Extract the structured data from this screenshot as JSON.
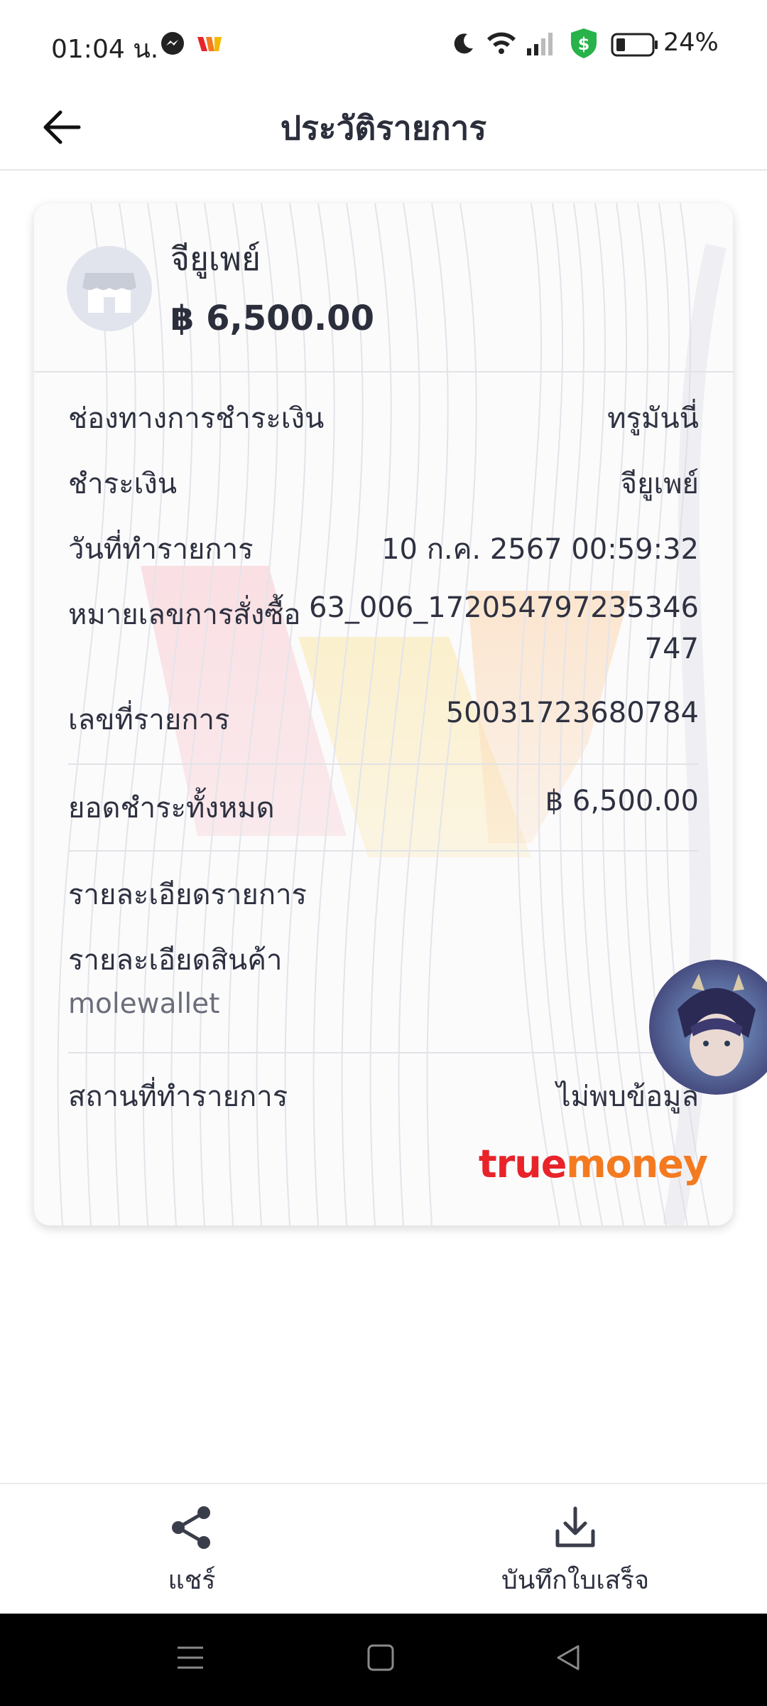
{
  "status_bar": {
    "time": "01:04 น.",
    "battery": "24%",
    "icons": [
      "messenger-icon",
      "app-icon",
      "moon-icon",
      "wifi-icon",
      "signal-icon",
      "shield-dollar-icon",
      "battery-icon"
    ]
  },
  "header": {
    "title": "ประวัติรายการ",
    "back_icon": "arrow-left-icon"
  },
  "merchant": {
    "name": "จียูเพย์",
    "amount": "฿ 6,500.00",
    "icon": "store-icon"
  },
  "details": {
    "payment_channel": {
      "label": "ช่องทางการชำระเงิน",
      "value": "ทรูมันนี่"
    },
    "paid_to": {
      "label": "ชำระเงิน",
      "value": "จียูเพย์"
    },
    "transaction_date": {
      "label": "วันที่ทำรายการ",
      "value": "10 ก.ค. 2567 00:59:32"
    },
    "order_number": {
      "label": "หมายเลขการสั่งซื้อ",
      "value_line1": "63_006_172054797235346",
      "value_line2": "747"
    },
    "transaction_number": {
      "label": "เลขที่รายการ",
      "value": "50031723680784"
    },
    "total": {
      "label": "ยอดชำระทั้งหมด",
      "value": "฿ 6,500.00"
    },
    "transaction_details_heading": "รายละเอียดรายการ",
    "product_details": {
      "label": "รายละเอียดสินค้า",
      "value": "molewallet"
    },
    "location": {
      "label": "สถานที่ทำรายการ",
      "value": "ไม่พบข้อมูล"
    }
  },
  "brand": {
    "part1": "true",
    "part2": "money",
    "color_true": "#e8232a",
    "color_money": "#f47a20"
  },
  "bottom_actions": {
    "share_label": "แชร์",
    "save_label": "บันทึกใบเสร็จ",
    "share_icon": "share-icon",
    "save_icon": "download-icon"
  },
  "nav": [
    "menu-icon",
    "home-square-icon",
    "back-triangle-icon"
  ]
}
